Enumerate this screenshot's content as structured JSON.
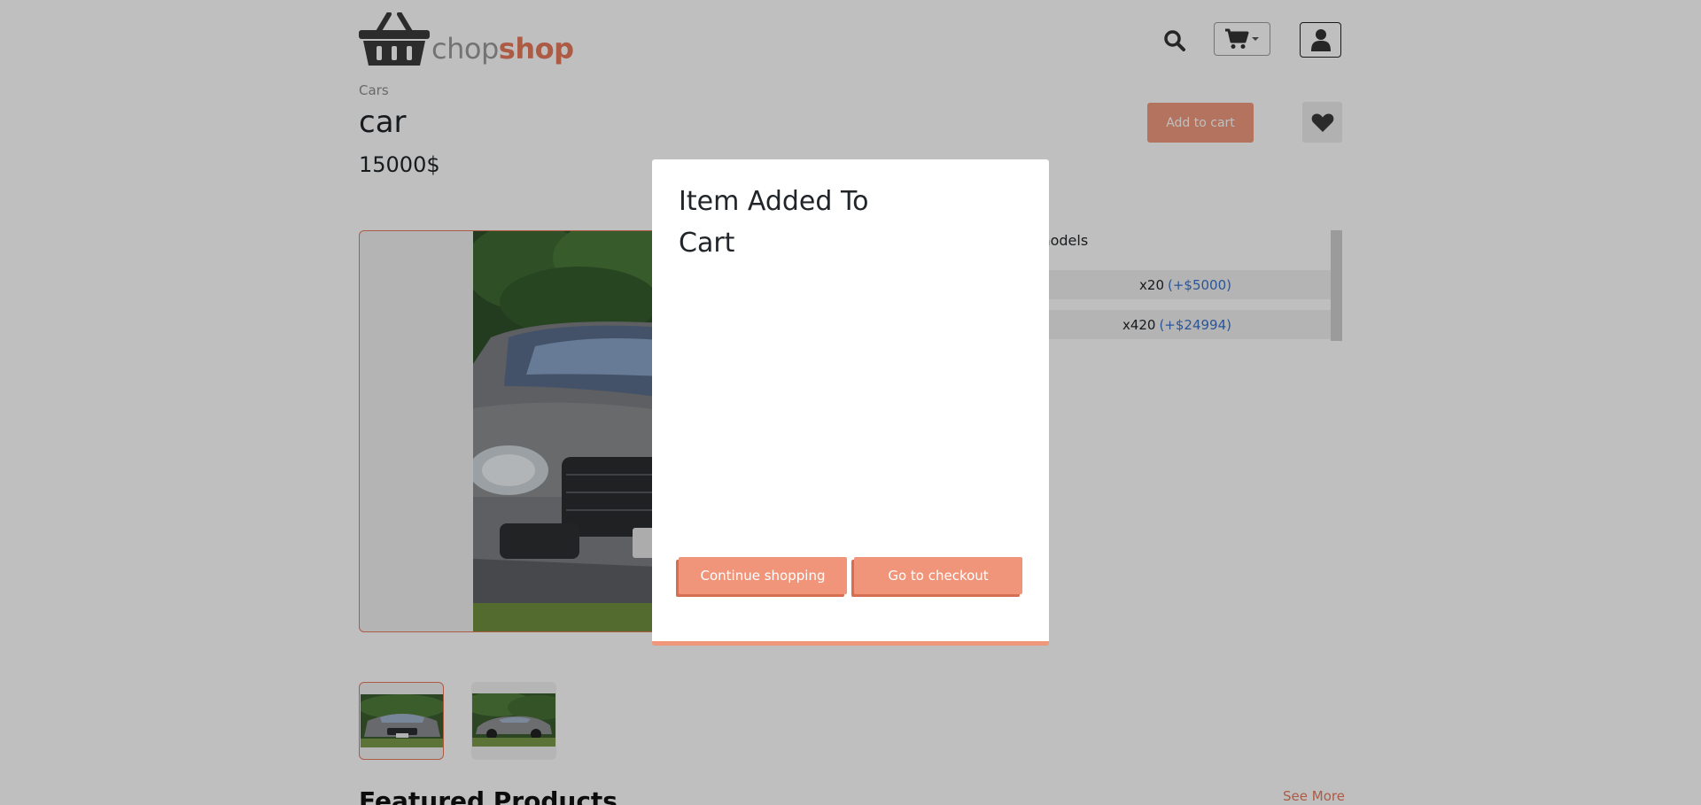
{
  "header": {
    "logo_part1": "chop",
    "logo_part2": "shop",
    "search_icon": "search-icon",
    "cart_icon": "shopping-cart-icon",
    "user_icon": "user-icon"
  },
  "product": {
    "breadcrumb": "Cars",
    "title": "car",
    "price": "15000$",
    "add_to_cart_label": "Add to cart",
    "wishlist_icon": "heart-icon"
  },
  "models": {
    "label": "models",
    "options": [
      {
        "name": "x20",
        "extra": "(+$5000)"
      },
      {
        "name": "x420",
        "extra": "(+$24994)"
      }
    ]
  },
  "featured": {
    "title": "Featured Products",
    "see_more": "See More"
  },
  "modal": {
    "title": "Item Added To Cart",
    "continue_label": "Continue shopping",
    "checkout_label": "Go to checkout"
  },
  "colors": {
    "brand": "#e87a5d",
    "button": "#f1957a",
    "link": "#3a72c8"
  }
}
